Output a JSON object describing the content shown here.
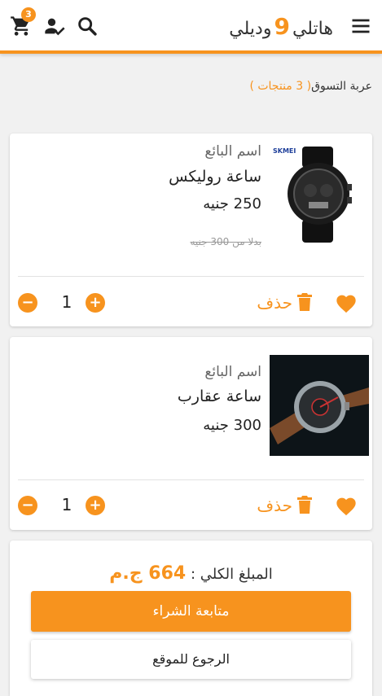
{
  "header": {
    "logo_text": "هاتلي",
    "logo_number": "9",
    "logo_text2": "وديلي",
    "cart_count": "3",
    "icons": [
      "menu-icon",
      "search-icon",
      "account-check-icon",
      "cart-icon"
    ]
  },
  "cart": {
    "title": "عربة التسوق",
    "count_text": "( 3 منتجات )"
  },
  "items": [
    {
      "vendor": "اسم البائع",
      "name": "ساعة روليكس",
      "price": "250 جنيه",
      "old_price": "بدلا من 300 جنيه",
      "brand_label": "SKMEI",
      "quantity": "1",
      "delete_label": "حذف"
    },
    {
      "vendor": "اسم البائع",
      "name": "ساعة عقارب",
      "price": "300 جنيه",
      "quantity": "1",
      "delete_label": "حذف"
    }
  ],
  "summary": {
    "total_label": "المبلغ الكلي :",
    "total_amount": "664 ج.م",
    "checkout_label": "متابعة الشراء",
    "back_label": "الرجوع للموقع"
  },
  "colors": {
    "accent": "#f7931e",
    "background": "#f1f1f1"
  }
}
